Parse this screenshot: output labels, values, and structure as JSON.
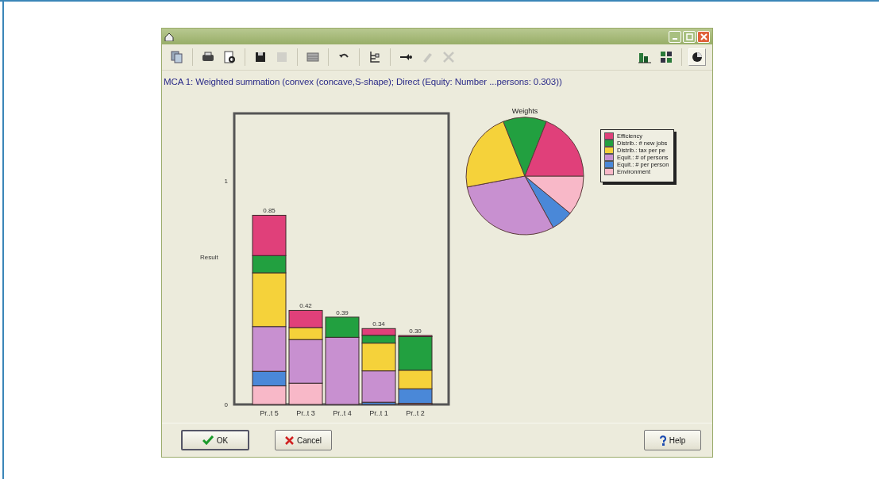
{
  "toolbar": {
    "left": [
      {
        "kind": "copy",
        "disabled": false
      },
      {
        "kind": "print",
        "disabled": false
      },
      {
        "kind": "preview",
        "disabled": false
      },
      {
        "kind": "save",
        "disabled": false
      },
      {
        "kind": "blank",
        "disabled": true
      },
      {
        "kind": "table",
        "disabled": false
      },
      {
        "kind": "undo",
        "disabled": false
      },
      {
        "kind": "tree",
        "disabled": false
      },
      {
        "kind": "link",
        "disabled": false
      },
      {
        "kind": "edit",
        "disabled": true
      },
      {
        "kind": "delete",
        "disabled": true
      }
    ],
    "right": [
      {
        "kind": "bars",
        "selected": false
      },
      {
        "kind": "grid",
        "selected": false
      },
      {
        "kind": "pie",
        "selected": true
      }
    ]
  },
  "heading": "MCA 1: Weighted summation (convex (concave,S-shape); Direct (Equity: Number ...persons: 0.303))",
  "chart_data": {
    "type": "bar",
    "stacked": true,
    "ylabel": "Result",
    "ylim": [
      0,
      1.3
    ],
    "yticks": [
      0,
      1
    ],
    "categories": [
      "Pr..t 5",
      "Pr..t 3",
      "Pr..t 4",
      "Pr..t 1",
      "Pr..t 2"
    ],
    "value_labels": [
      "0.85",
      "0.42",
      "0.39",
      "0.34",
      "0.30"
    ],
    "series": [
      {
        "name": "Environment",
        "color": "#f8b8c8",
        "values": [
          0.083,
          0.095,
          0,
          0,
          0.005
        ]
      },
      {
        "name": "Equit.: # per person",
        "color": "#4a88d8",
        "values": [
          0.065,
          0,
          0,
          0.01,
          0.065
        ]
      },
      {
        "name": "Equit.: # of persons",
        "color": "#c890d0",
        "values": [
          0.2,
          0.195,
          0.3,
          0.14,
          0
        ]
      },
      {
        "name": "Distrib.: tax per pe",
        "color": "#f5d23a",
        "values": [
          0.24,
          0.053,
          0,
          0.124,
          0.083
        ]
      },
      {
        "name": "Distrib.: # new jobs",
        "color": "#22a040",
        "values": [
          0.077,
          0,
          0.09,
          0.035,
          0.15
        ]
      },
      {
        "name": "Efficiency",
        "color": "#e0407a",
        "values": [
          0.18,
          0.077,
          0,
          0.03,
          0.005
        ]
      }
    ]
  },
  "pie": {
    "title": "Weights"
  },
  "buttons": [
    {
      "kind": "ok",
      "label": "OK"
    },
    {
      "kind": "cancel",
      "label": "Cancel"
    },
    {
      "kind": "help",
      "label": "Help"
    }
  ]
}
